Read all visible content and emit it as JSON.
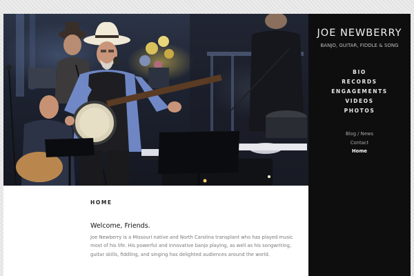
{
  "site": {
    "title": "JOE NEWBERRY",
    "subtitle": "BANJO, GUITAR, FIDDLE & SONG"
  },
  "nav": {
    "primary": [
      {
        "label": "BIO"
      },
      {
        "label": "RECORDS"
      },
      {
        "label": "ENGAGEMENTS"
      },
      {
        "label": "VIDEOS"
      },
      {
        "label": "PHOTOS"
      }
    ],
    "secondary": [
      {
        "label": "Blog / News",
        "active": false
      },
      {
        "label": "Contact",
        "active": false
      },
      {
        "label": "Home",
        "active": true
      }
    ]
  },
  "content": {
    "kicker": "HOME",
    "heading": "Welcome, Friends.",
    "body": "Joe Newberry is a Missouri native and North Carolina transplant who has played music most of his life. His powerful and innovative banjo playing, as well as his songwriting, guitar skills, fiddling, and singing has delighted audiences around the world."
  },
  "colors": {
    "sidebar_bg": "#0e0e0e",
    "page_bg": "#e3e3e3",
    "content_bg": "#ffffff"
  }
}
